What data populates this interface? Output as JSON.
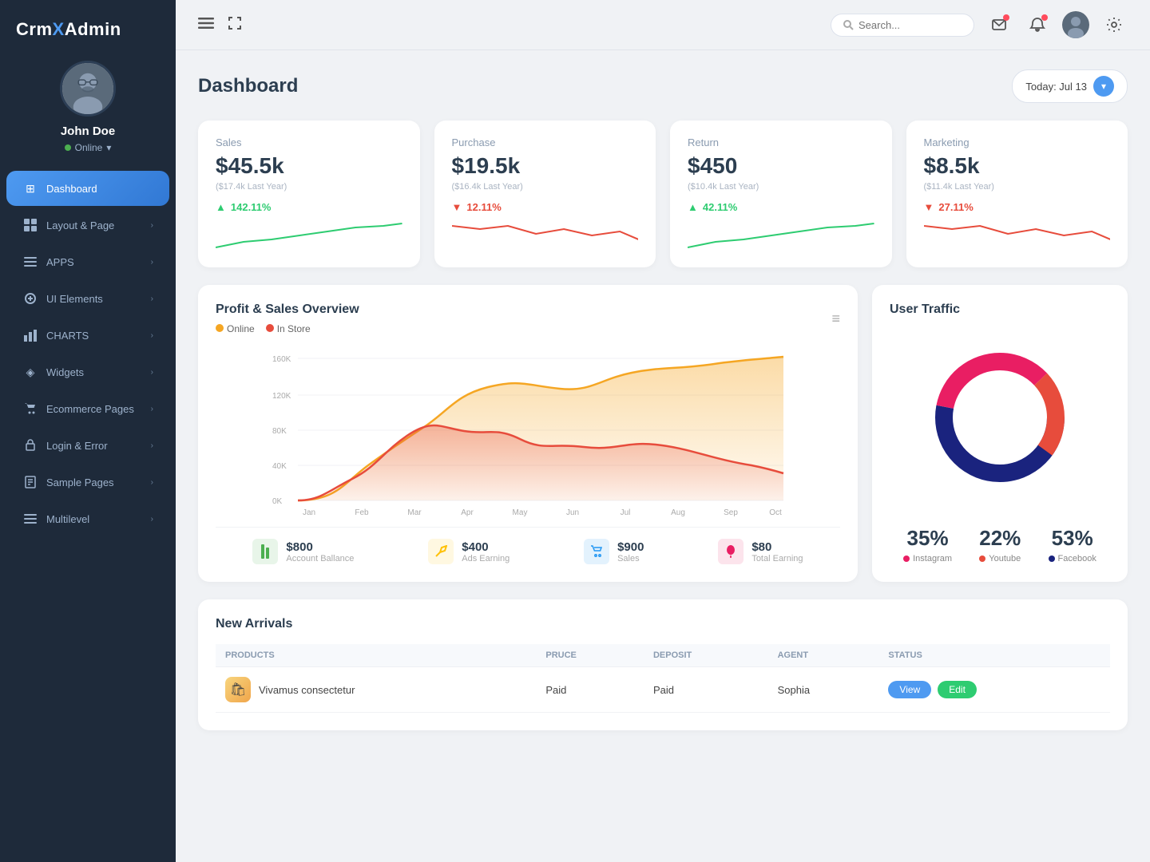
{
  "brand": {
    "prefix": "CrmX",
    "suffix": "Admin"
  },
  "profile": {
    "name": "John Doe",
    "status": "Online",
    "avatar_initial": "👤"
  },
  "sidebar": {
    "items": [
      {
        "id": "dashboard",
        "label": "Dashboard",
        "icon": "⊞",
        "active": true,
        "hasChildren": false
      },
      {
        "id": "layout",
        "label": "Layout & Page",
        "icon": "▦",
        "active": false,
        "hasChildren": true
      },
      {
        "id": "apps",
        "label": "APPS",
        "icon": "≡",
        "active": false,
        "hasChildren": true
      },
      {
        "id": "ui",
        "label": "UI Elements",
        "icon": "✏",
        "active": false,
        "hasChildren": true
      },
      {
        "id": "charts",
        "label": "CHARTS",
        "icon": "📊",
        "active": false,
        "hasChildren": true
      },
      {
        "id": "widgets",
        "label": "Widgets",
        "icon": "◈",
        "active": false,
        "hasChildren": true
      },
      {
        "id": "ecommerce",
        "label": "Ecommerce Pages",
        "icon": "🛒",
        "active": false,
        "hasChildren": true
      },
      {
        "id": "login",
        "label": "Login & Error",
        "icon": "🔐",
        "active": false,
        "hasChildren": true
      },
      {
        "id": "sample",
        "label": "Sample Pages",
        "icon": "📄",
        "active": false,
        "hasChildren": true
      },
      {
        "id": "multilevel",
        "label": "Multilevel",
        "icon": "≡",
        "active": false,
        "hasChildren": true
      }
    ]
  },
  "topbar": {
    "search_placeholder": "Search...",
    "date_label": "Today: Jul 13"
  },
  "page": {
    "title": "Dashboard"
  },
  "stat_cards": [
    {
      "label": "Sales",
      "value": "$45.5k",
      "sub": "($17.4k Last Year)",
      "trend_pct": "142.11%",
      "trend_dir": "up",
      "color": "#2ecc71"
    },
    {
      "label": "Purchase",
      "value": "$19.5k",
      "sub": "($16.4k Last Year)",
      "trend_pct": "12.11%",
      "trend_dir": "down",
      "color": "#e74c3c"
    },
    {
      "label": "Return",
      "value": "$450",
      "sub": "($10.4k Last Year)",
      "trend_pct": "42.11%",
      "trend_dir": "up",
      "color": "#2ecc71"
    },
    {
      "label": "Marketing",
      "value": "$8.5k",
      "sub": "($11.4k Last Year)",
      "trend_pct": "27.11%",
      "trend_dir": "down",
      "color": "#e74c3c"
    }
  ],
  "profit_chart": {
    "title": "Profit & Sales Overview",
    "legend": [
      {
        "label": "Online",
        "color": "#f5a623"
      },
      {
        "label": "In Store",
        "color": "#e74c3c"
      }
    ],
    "x_labels": [
      "Jan",
      "Feb",
      "Mar",
      "Apr",
      "May",
      "Jun",
      "Jul",
      "Aug",
      "Sep",
      "Oct"
    ],
    "y_labels": [
      "160K",
      "120K",
      "80K",
      "40K",
      "0K"
    ]
  },
  "user_traffic": {
    "title": "User Traffic",
    "segments": [
      {
        "label": "Instagram",
        "pct": 35,
        "color": "#e91e63"
      },
      {
        "label": "Youtube",
        "pct": 22,
        "color": "#e74c3c"
      },
      {
        "label": "Facebook",
        "pct": 53,
        "color": "#1a237e"
      }
    ]
  },
  "bottom_stats": [
    {
      "label": "Account Ballance",
      "value": "$800",
      "icon_color": "#e8f5e9",
      "icon": "▌▌",
      "icon_text_color": "#4caf50"
    },
    {
      "label": "Ads Earning",
      "value": "$400",
      "icon_color": "#fff8e1",
      "icon": "✏",
      "icon_text_color": "#ffc107"
    },
    {
      "label": "Sales",
      "value": "$900",
      "icon_color": "#e3f2fd",
      "icon": "🛒",
      "icon_text_color": "#2196f3"
    },
    {
      "label": "Total Earning",
      "value": "$80",
      "icon_color": "#fce4ec",
      "icon": "💧",
      "icon_text_color": "#e91e63"
    }
  ],
  "new_arrivals": {
    "title": "New Arrivals",
    "columns": [
      "PRODUCTS",
      "PRUCE",
      "DEPOSIT",
      "AGENT",
      "STATUS"
    ],
    "rows": [
      {
        "product": "Vivamus consectetur",
        "product_icon": "🛍",
        "price": "Paid",
        "deposit": "Paid",
        "agent": "Sophia",
        "status_color": "#4e9af1"
      }
    ]
  }
}
